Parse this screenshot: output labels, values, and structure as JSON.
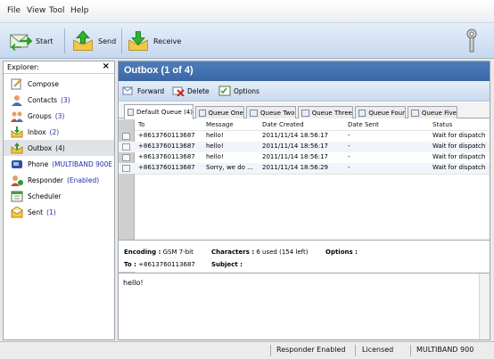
{
  "menu": [
    "File",
    "View",
    "Tool",
    "Help"
  ],
  "toolbar": {
    "start_label": "Start",
    "send_label": "Send",
    "receive_label": "Receive"
  },
  "explorer": {
    "title": "Explorer:",
    "close_glyph": "×",
    "items": [
      {
        "label": "Compose",
        "count": ""
      },
      {
        "label": "Contacts",
        "count": "(3)"
      },
      {
        "label": "Groups",
        "count": "(3)"
      },
      {
        "label": "Inbox",
        "count": "(2)"
      },
      {
        "label": "Outbox",
        "count": "(4)"
      },
      {
        "label": "Phone",
        "count": "(MULTIBAND 900E"
      },
      {
        "label": "Responder",
        "count": "(Enabled)"
      },
      {
        "label": "Scheduler",
        "count": ""
      },
      {
        "label": "Sent",
        "count": "(1)"
      }
    ]
  },
  "outbox": {
    "title": "Outbox (1 of 4)",
    "actions": {
      "forward": "Forward",
      "delete": "Delete",
      "options": "Options"
    },
    "tabs": [
      "Default Queue (4)",
      "Queue One",
      "Queue Two",
      "Queue Three",
      "Queue Four",
      "Queue Five"
    ],
    "columns": [
      "To",
      "Message",
      "Date Created",
      "Date Sent",
      "Status"
    ],
    "rows": [
      {
        "to": "+8613760113687",
        "message": "hello!",
        "created": "2011/11/14 18:56:17",
        "sent": "-",
        "status": "Wait for dispatch"
      },
      {
        "to": "+8613760113687",
        "message": "hello!",
        "created": "2011/11/14 18:56:17",
        "sent": "-",
        "status": "Wait for dispatch"
      },
      {
        "to": "+8613760113687",
        "message": "hello!",
        "created": "2011/11/14 18:56:17",
        "sent": "-",
        "status": "Wait for dispatch"
      },
      {
        "to": "+8613760113687",
        "message": "Sorry, we do ...",
        "created": "2011/11/14 18:56:29",
        "sent": "-",
        "status": "Wait for dispatch"
      }
    ],
    "details": {
      "encoding_label": "Encoding :",
      "encoding_value": "GSM 7-bit",
      "characters_label": "Characters :",
      "characters_value": "6 used (154 left)",
      "options_label": "Options :",
      "to_label": "To :",
      "to_value": "+8613760113687",
      "subject_label": "Subject :"
    },
    "message_body": "hello!"
  },
  "statusbar": {
    "responder": "Responder Enabled",
    "license": "Licensed",
    "device": "MULTIBAND  900"
  },
  "colors": {
    "header_blue": "#3f6dab",
    "count_blue": "#1f2fb0",
    "selected_row": "#dfe3e8"
  }
}
